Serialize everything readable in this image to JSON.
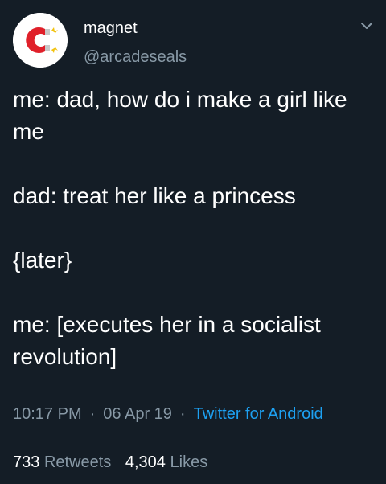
{
  "account": {
    "display_name": "magnet",
    "handle": "@arcadeseals",
    "avatar_icon": "magnet-icon"
  },
  "tweet": {
    "lines": [
      "me: dad, how do i make a girl like me",
      "dad: treat her like a princess",
      "{later}",
      "me: [executes her in a socialist revolution]"
    ],
    "time": "10:17 PM",
    "date": "06 Apr 19",
    "separator": "·",
    "source": "Twitter for Android"
  },
  "stats": {
    "retweets_count": "733",
    "retweets_label": "Retweets",
    "likes_count": "4,304",
    "likes_label": "Likes"
  },
  "colors": {
    "background": "#141d26",
    "text": "#ffffff",
    "muted": "#8899a6",
    "link": "#1da1f2",
    "magnet_red": "#e0202a"
  }
}
